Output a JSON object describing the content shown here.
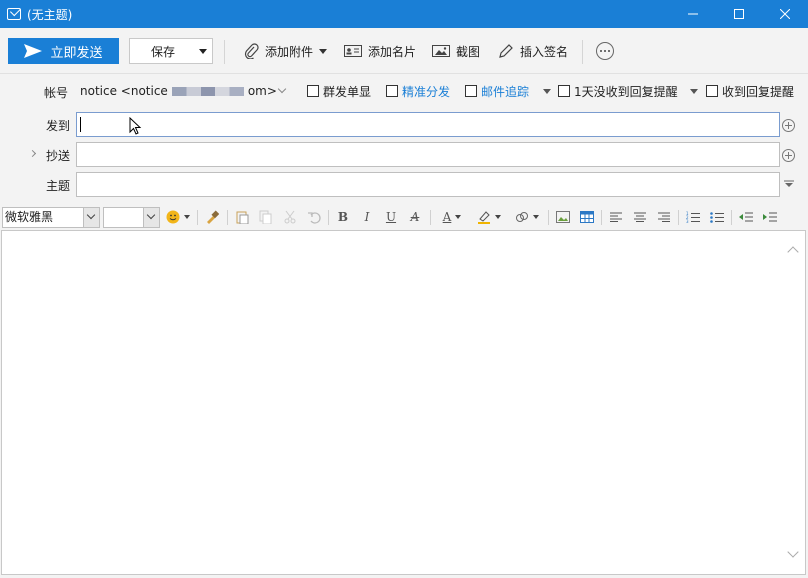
{
  "window": {
    "title": "(无主题)",
    "accent_color": "#1a7fd6"
  },
  "toolbar": {
    "send_label": "立即发送",
    "save_label": "保存",
    "attach_label": "添加附件",
    "card_label": "添加名片",
    "screenshot_label": "截图",
    "signature_label": "插入签名",
    "more_icon": "ellipsis-icon"
  },
  "header": {
    "account_label": "帐号",
    "account_prefix": "notice <notice",
    "account_suffix": "om>",
    "options": {
      "group_single": "群发单显",
      "precise_split": "精准分发",
      "mail_track": "邮件追踪",
      "no_reply_remind": "1天没收到回复提醒",
      "reply_remind": "收到回复提醒"
    },
    "to_label": "发到",
    "to_value": "",
    "cc_label": "抄送",
    "cc_value": "",
    "subject_label": "主题",
    "subject_value": ""
  },
  "format": {
    "font_name": "微软雅黑",
    "font_size": "",
    "bold": "B",
    "italic": "I",
    "underline": "U",
    "strike": "A",
    "font_color": "A"
  },
  "editor": {
    "content": ""
  }
}
